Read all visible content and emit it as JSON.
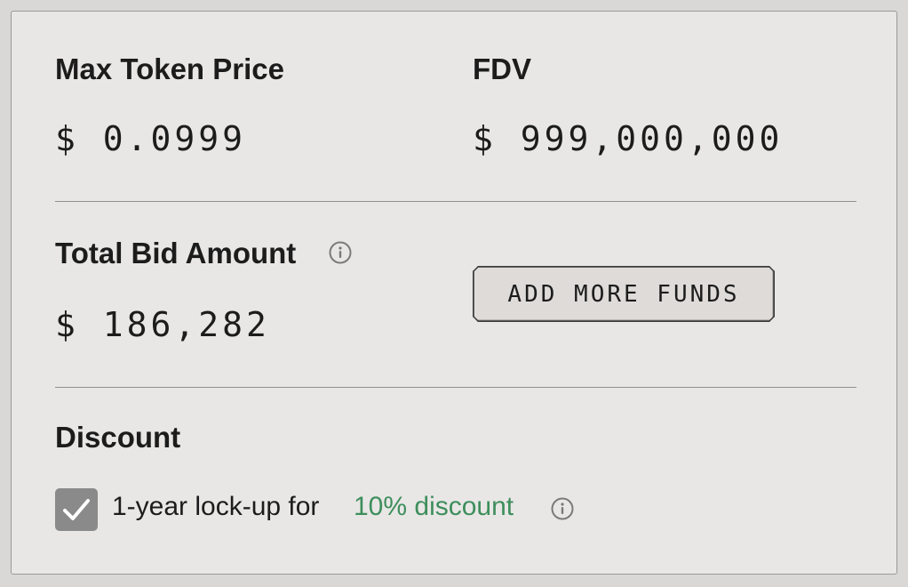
{
  "pricing": {
    "max_token_price_label": "Max Token Price",
    "max_token_price_value": "$ 0.0999",
    "fdv_label": "FDV",
    "fdv_value": "$ 999,000,000"
  },
  "bid": {
    "total_bid_label": "Total Bid Amount",
    "total_bid_value": "$ 186,282",
    "info_icon": "info-icon",
    "add_funds_label": "ADD MORE FUNDS"
  },
  "discount": {
    "heading": "Discount",
    "checked": true,
    "lockup_text": "1-year lock-up for",
    "discount_text": "10% discount",
    "info_icon": "info-icon"
  },
  "colors": {
    "panel_bg": "#e8e7e6",
    "accent_green": "#3e8e5c",
    "checkbox_bg": "#8a8a8a",
    "text": "#1c1c1c"
  }
}
